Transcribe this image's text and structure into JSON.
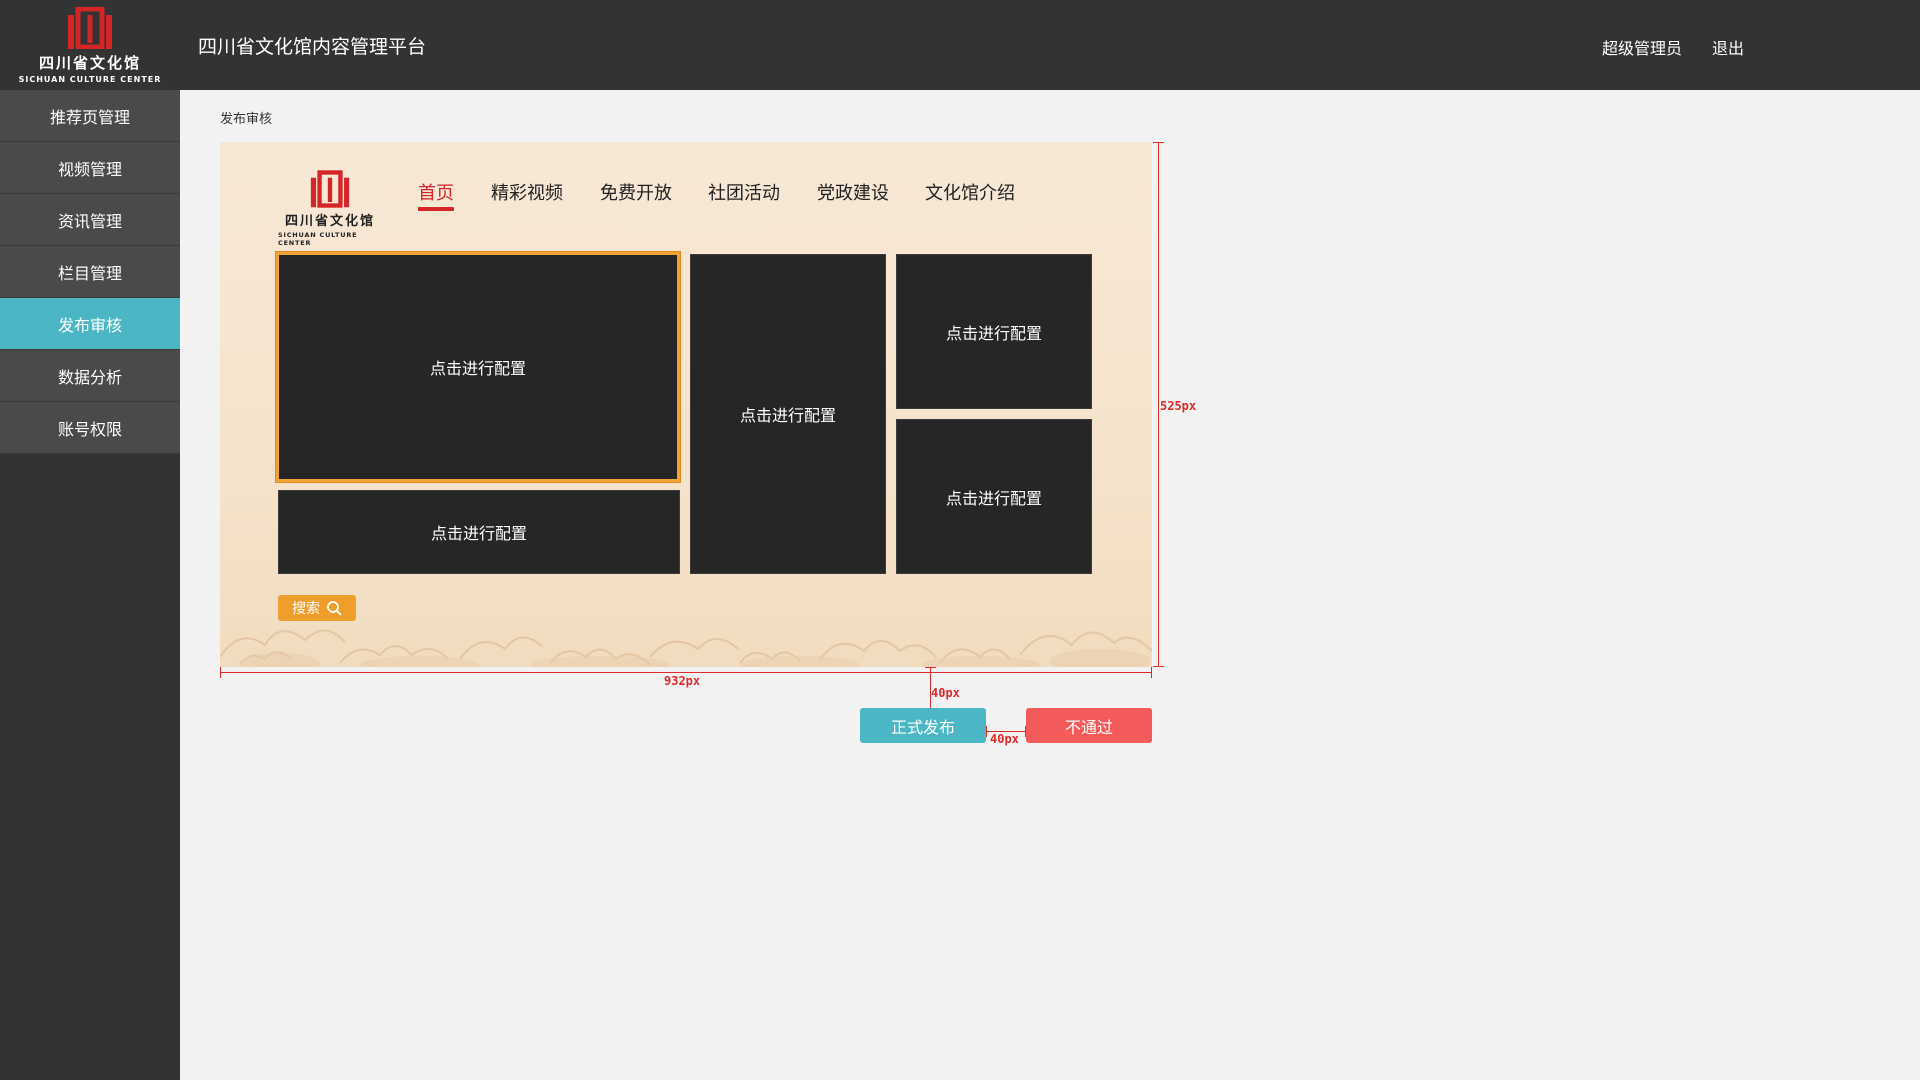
{
  "header": {
    "logo_cn": "四川省文化馆",
    "logo_en": "SICHUAN CULTURE CENTER",
    "platform_title": "四川省文化馆内容管理平台",
    "user_label": "超级管理员",
    "logout_label": "退出",
    "colors": {
      "bar": "#333333",
      "logo_red": "#d42626"
    }
  },
  "sidebar": {
    "items": [
      {
        "label": "推荐页管理",
        "active": false
      },
      {
        "label": "视频管理",
        "active": false
      },
      {
        "label": "资讯管理",
        "active": false
      },
      {
        "label": "栏目管理",
        "active": false
      },
      {
        "label": "发布审核",
        "active": true
      },
      {
        "label": "数据分析",
        "active": false
      },
      {
        "label": "账号权限",
        "active": false
      }
    ],
    "active_color": "#4bb7c4"
  },
  "main": {
    "breadcrumb": "发布审核",
    "preview": {
      "logo_cn": "四川省文化馆",
      "logo_en": "SICHUAN CULTURE CENTER",
      "nav": [
        {
          "label": "首页",
          "active": true
        },
        {
          "label": "精彩视频",
          "active": false
        },
        {
          "label": "免费开放",
          "active": false
        },
        {
          "label": "社团活动",
          "active": false
        },
        {
          "label": "党政建设",
          "active": false
        },
        {
          "label": "文化馆介绍",
          "active": false
        }
      ],
      "tiles": [
        {
          "label": "点击进行配置",
          "selected": true
        },
        {
          "label": "点击进行配置",
          "selected": false
        },
        {
          "label": "点击进行配置",
          "selected": false
        },
        {
          "label": "点击进行配置",
          "selected": false
        },
        {
          "label": "点击进行配置",
          "selected": false
        }
      ],
      "search_label": "搜索",
      "nav_active_color": "#d42626",
      "search_color": "#ef9e2c"
    },
    "annotations": {
      "width_label": "932px",
      "height_label": "525px",
      "gap_vertical_label": "40px",
      "gap_horizontal_label": "40px"
    },
    "actions": {
      "publish_label": "正式发布",
      "reject_label": "不通过",
      "publish_color": "#4bb7c4",
      "reject_color": "#f35b5b"
    }
  }
}
